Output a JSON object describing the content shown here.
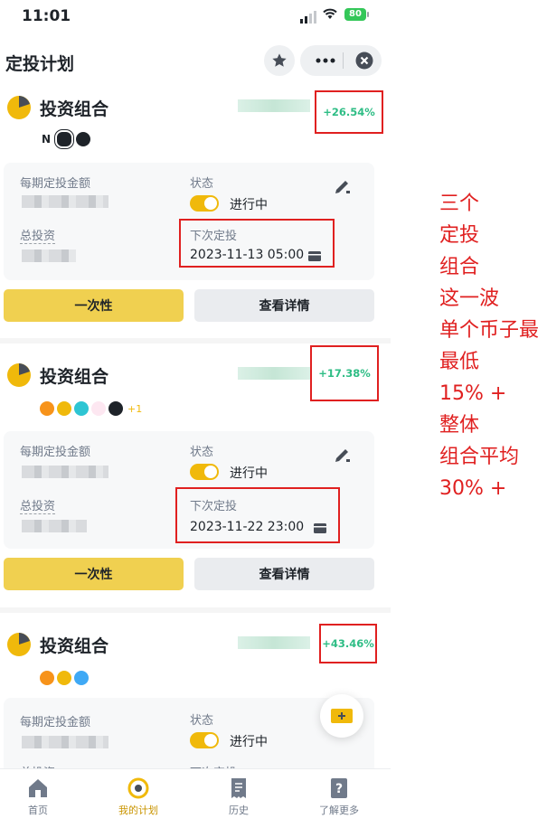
{
  "status_bar": {
    "time": "11:01",
    "battery": "80"
  },
  "header": {
    "title": "定投计划"
  },
  "plans": [
    {
      "name": "投资组合",
      "return": "+26.54%",
      "coins": [
        "near",
        "sol-swirl",
        "layerzero"
      ],
      "coins_more": "",
      "amount_label": "每期定投金额",
      "status_label": "状态",
      "status_value": "进行中",
      "total_label": "总投资",
      "next_label": "下次定投",
      "next_date": "2023-11-13 05:00",
      "btn_once": "一次性",
      "btn_details": "查看详情"
    },
    {
      "name": "投资组合",
      "return": "+17.38%",
      "coins": [
        "btc",
        "bnb",
        "stellar",
        "uni",
        "x"
      ],
      "coins_more": "+1",
      "amount_label": "每期定投金额",
      "status_label": "状态",
      "status_value": "进行中",
      "total_label": "总投资",
      "next_label": "下次定投",
      "next_date": "2023-11-22 23:00",
      "btn_once": "一次性",
      "btn_details": "查看详情"
    },
    {
      "name": "投资组合",
      "return": "+43.46%",
      "coins": [
        "btc",
        "bnb",
        "blue"
      ],
      "coins_more": "",
      "amount_label": "每期定投金额",
      "status_label": "状态",
      "status_value": "进行中",
      "total_label": "总投资",
      "next_label": "下次定投"
    }
  ],
  "bottom_nav": [
    {
      "label": "首页",
      "icon": "home-icon"
    },
    {
      "label": "我的计划",
      "icon": "plan-icon",
      "active": true
    },
    {
      "label": "历史",
      "icon": "history-icon"
    },
    {
      "label": "了解更多",
      "icon": "help-icon"
    }
  ],
  "annotation": {
    "lines": [
      "三个",
      "定投",
      "组合",
      "这一波",
      "单个币子最",
      "最低",
      "15% +",
      "整体",
      "组合平均",
      "30% +"
    ]
  },
  "colors": {
    "accent": "#f0b90b",
    "positive": "#2ebd85",
    "highlight": "#e02020"
  }
}
